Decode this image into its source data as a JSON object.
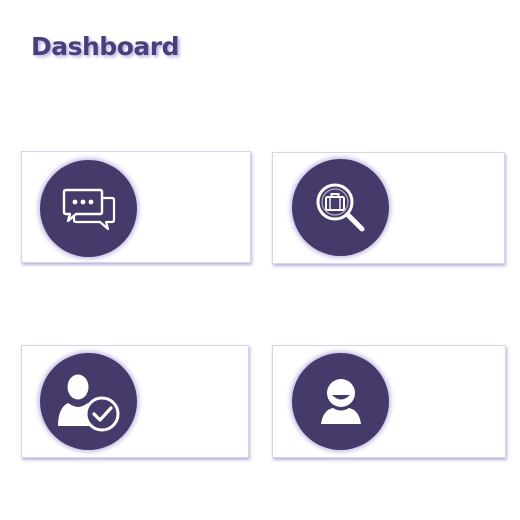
{
  "header": {
    "title": "Dashboard"
  },
  "cards": [
    {
      "icon": "chat-bubbles-icon"
    },
    {
      "icon": "job-search-icon"
    },
    {
      "icon": "user-verified-icon"
    },
    {
      "icon": "user-avatar-icon"
    }
  ],
  "colors": {
    "accent": "#463a6b",
    "title": "#4a3f7a",
    "card_border": "#d8d4ea",
    "background": "#ffffff"
  }
}
